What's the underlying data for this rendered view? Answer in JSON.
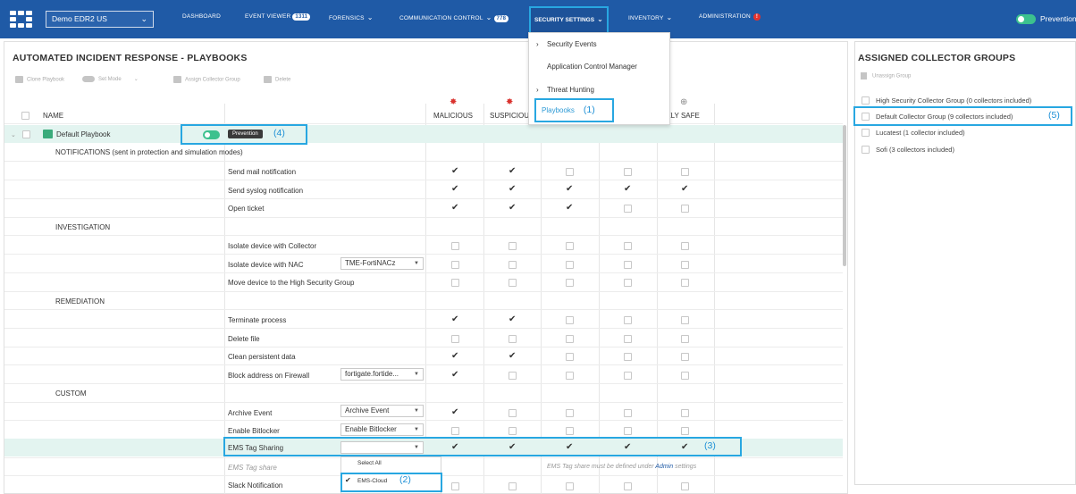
{
  "topbar": {
    "tenant": "Demo EDR2 US",
    "nav": {
      "dashboard": "DASHBOARD",
      "event_viewer": "EVENT VIEWER",
      "event_viewer_count": "1311",
      "forensics": "FORENSICS",
      "communication_control": "COMMUNICATION CONTROL",
      "communication_count": "778",
      "security_settings": "SECURITY SETTINGS",
      "inventory": "INVENTORY",
      "administration": "ADMINISTRATION",
      "administration_alert": "!"
    },
    "mode_label": "Prevention"
  },
  "security_menu": {
    "items": [
      "Security Events",
      "Application Control Manager",
      "Threat Hunting"
    ],
    "playbooks": "Playbooks",
    "annotation": "(1)"
  },
  "main": {
    "title": "AUTOMATED INCIDENT RESPONSE - PLAYBOOKS",
    "toolbar": {
      "clone": "Clone Playbook",
      "set_mode": "Set Mode",
      "assign": "Assign Collector Group",
      "delete": "Delete"
    },
    "columns": {
      "name": "NAME",
      "malicious": "MALICIOUS",
      "suspicious": "SUSPICIOU",
      "likely_safe": "KELY SAFE"
    },
    "playbook": {
      "name": "Default Playbook",
      "mode": "Prevention",
      "annotation": "(4)"
    },
    "sections": {
      "notifications": "NOTIFICATIONS  (sent in protection and simulation modes)",
      "investigation": "INVESTIGATION",
      "remediation": "REMEDIATION",
      "custom": "CUSTOM"
    },
    "actions": {
      "send_mail": "Send mail notification",
      "send_syslog": "Send syslog notification",
      "open_ticket": "Open ticket",
      "isolate_collector": "Isolate device with Collector",
      "isolate_nac": "Isolate device with NAC",
      "nac_value": "TME-FortiNACz",
      "move_high_sec": "Move device to the High Security Group",
      "terminate": "Terminate process",
      "delete_file": "Delete file",
      "clean_data": "Clean persistent data",
      "block_address": "Block address on Firewall",
      "firewall_value": "fortigate.fortide...",
      "archive_event": "Archive Event",
      "archive_value": "Archive Event",
      "enable_bitlocker": "Enable Bitlocker",
      "bitlocker_value": "Enable Bitlocker",
      "ems_tag_sharing": "EMS Tag Sharing",
      "ems_annotation": "(3)",
      "ems_tag_share": "EMS Tag share",
      "ems_note_prefix": "EMS Tag share must be defined under",
      "ems_note_link": "Admin",
      "ems_note_suffix": "settings",
      "slack": "Slack Notification"
    },
    "ems_dropdown": {
      "select_all": "Select All",
      "option": "EMS-Cloud",
      "annotation": "(2)"
    }
  },
  "right": {
    "title": "ASSIGNED COLLECTOR GROUPS",
    "unassign": "Unassign Group",
    "groups": [
      "High Security Collector Group (0 collectors included)",
      "Default Collector Group (9 collectors included)",
      "Lucatest (1 collector included)",
      "Sofi (3 collectors included)"
    ],
    "annotation": "(5)"
  },
  "colors": {
    "nav_blue": "#1f5aa6",
    "highlight_blue": "#28a7e1",
    "row_highlight": "#e3f4f0",
    "toggle_green": "#3cc18e",
    "malicious_red": "#d9322e"
  }
}
